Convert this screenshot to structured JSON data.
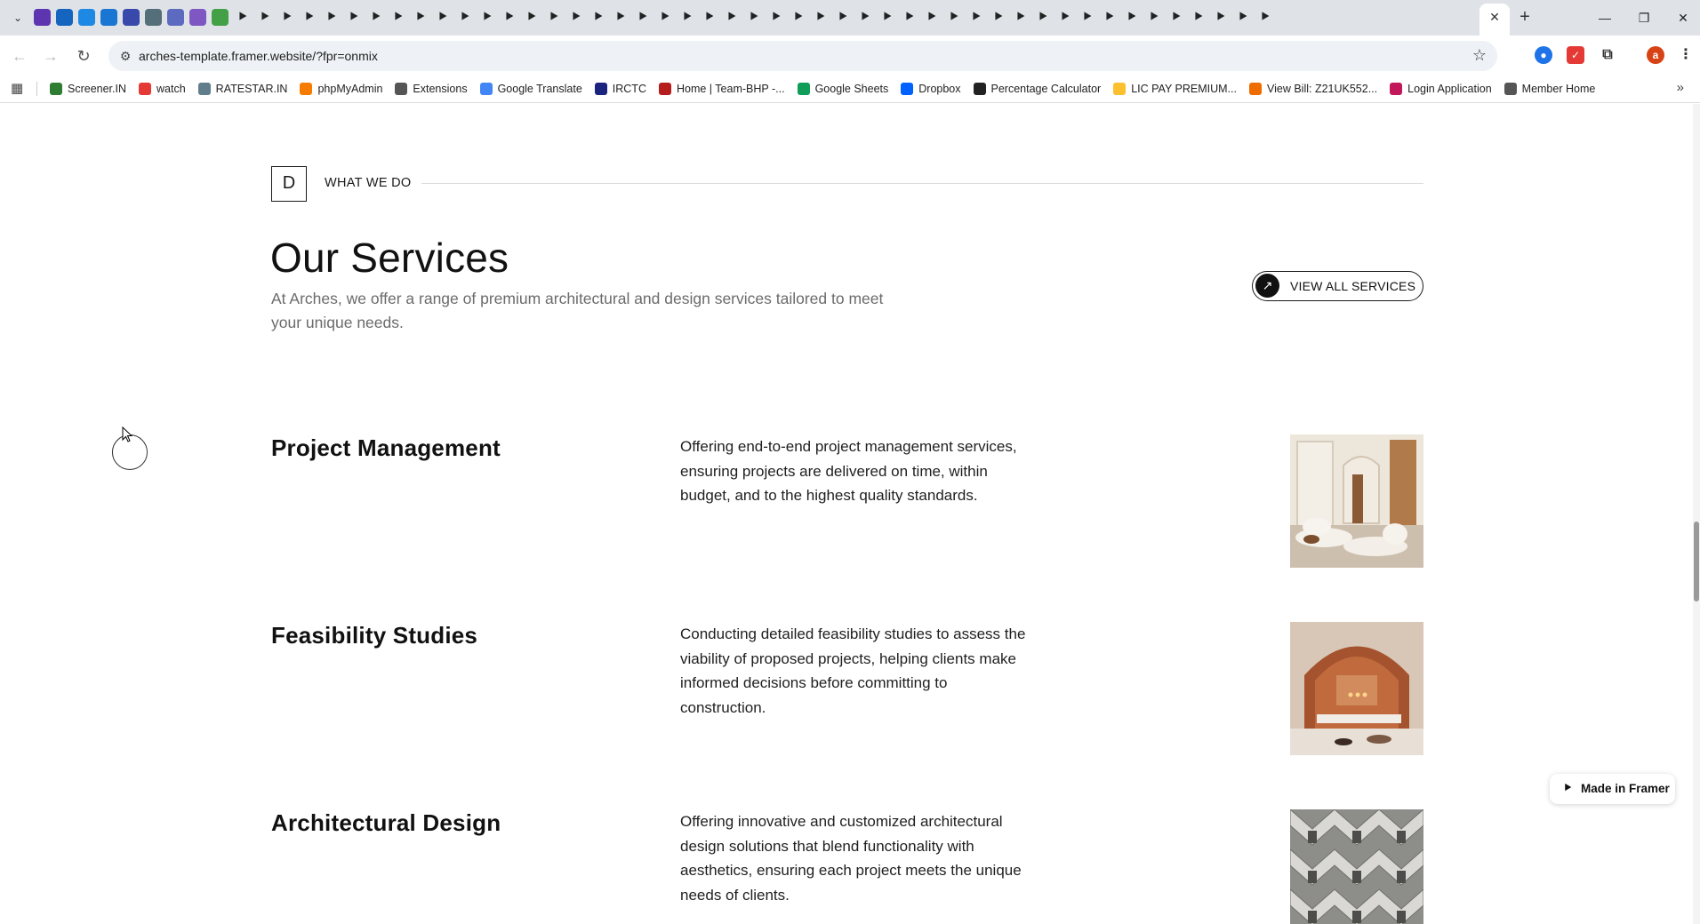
{
  "browser": {
    "url": "arches-template.framer.website/?fpr=onmix",
    "tab_close_glyph": "✕",
    "new_tab_glyph": "+",
    "profile_initial": "a",
    "bookmarks": [
      {
        "label": "Screener.IN",
        "icon": "bar-chart-icon",
        "color": "#2e7d32"
      },
      {
        "label": "watch",
        "icon": "youtube-icon",
        "color": "#e53935"
      },
      {
        "label": "RATESTAR.IN",
        "icon": "star-icon",
        "color": "#607d8b"
      },
      {
        "label": "phpMyAdmin",
        "icon": "phpmyadmin-icon",
        "color": "#f57c00"
      },
      {
        "label": "Extensions",
        "icon": "puzzle-icon",
        "color": "#555555"
      },
      {
        "label": "Google Translate",
        "icon": "translate-icon",
        "color": "#4285f4"
      },
      {
        "label": "IRCTC",
        "icon": "irctc-icon",
        "color": "#1a237e"
      },
      {
        "label": "Home | Team-BHP -...",
        "icon": "teambhp-icon",
        "color": "#b71c1c"
      },
      {
        "label": "Google Sheets",
        "icon": "sheets-icon",
        "color": "#0f9d58"
      },
      {
        "label": "Dropbox",
        "icon": "dropbox-icon",
        "color": "#0061fe"
      },
      {
        "label": "Percentage Calculator",
        "icon": "percent-icon",
        "color": "#222222"
      },
      {
        "label": "LIC PAY PREMIUM...",
        "icon": "lic-icon",
        "color": "#fbc02d"
      },
      {
        "label": "View Bill: Z21UK552...",
        "icon": "bill-icon",
        "color": "#ef6c00"
      },
      {
        "label": "Login Application",
        "icon": "login-icon",
        "color": "#c2185b"
      },
      {
        "label": "Member Home",
        "icon": "globe-icon",
        "color": "#555555"
      }
    ]
  },
  "section": {
    "badge_letter": "D",
    "eyebrow": "WHAT WE DO",
    "title": "Our Services",
    "subtitle": "At Arches, we offer a range of premium architectural and design services tailored to meet your unique needs.",
    "cta_label": "VIEW ALL SERVICES",
    "cta_icon": "↗"
  },
  "services": [
    {
      "title": "Project Management",
      "description": "Offering end-to-end project management services, ensuring projects are delivered on time, within budget, and to the highest quality standards.",
      "image": "interior-lounge-photo"
    },
    {
      "title": "Feasibility Studies",
      "description": "Conducting detailed feasibility studies to assess the viability of proposed projects, helping clients make informed decisions before committing to construction.",
      "image": "arched-room-photo"
    },
    {
      "title": "Architectural Design",
      "description": "Offering innovative and customized architectural design solutions that blend functionality with aesthetics, ensuring each project meets the unique needs of clients.",
      "image": "concrete-facade-photo"
    }
  ],
  "framer_badge": {
    "label": "Made in Framer"
  }
}
